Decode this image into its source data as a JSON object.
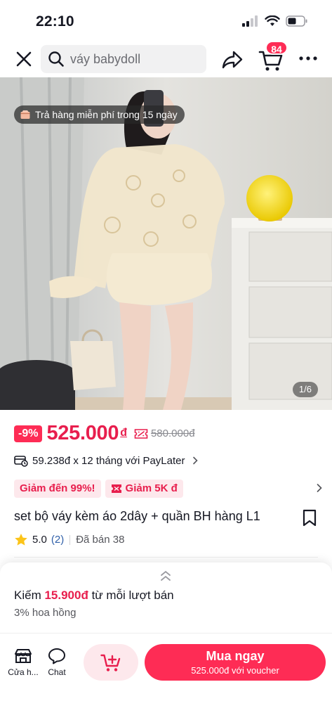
{
  "status_bar": {
    "time": "22:10"
  },
  "search": {
    "query": "váy babydoll"
  },
  "header": {
    "cart_count": "84"
  },
  "hero": {
    "return_policy": "Trả hàng miễn phí trong 15 ngày",
    "page_indicator": "1/6"
  },
  "pricing": {
    "discount": "-9%",
    "price": "525.000",
    "currency": "đ",
    "original_price": "580.000đ",
    "paylater": "59.238đ x 12 tháng với PayLater"
  },
  "promos": [
    "Giảm đến 99%!",
    "Giảm 5K đ"
  ],
  "product": {
    "title": "set bộ váy kèm áo 2dây + quần BH hàng L1",
    "rating": "5.0",
    "review_count": "(2)",
    "sold": "Đã bán 38"
  },
  "commission": {
    "earn_prefix": "Kiếm ",
    "earn_amount": "15.900đ",
    "earn_suffix": " từ mỗi lượt bán",
    "rate": "3% hoa hồng"
  },
  "bottom_bar": {
    "shop_label": "Cửa h...",
    "chat_label": "Chat",
    "buy_label": "Mua ngay",
    "buy_sub": "525.000đ với voucher"
  },
  "colors": {
    "accent": "#fe2c55",
    "price": "#e81e4d",
    "promo_bg": "#fde8ec"
  }
}
